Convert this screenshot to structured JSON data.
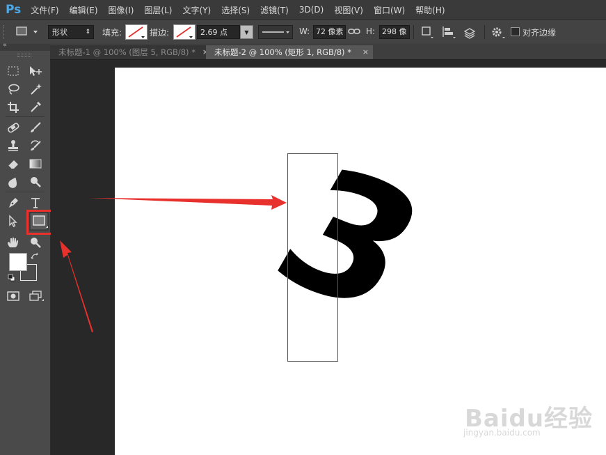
{
  "app": {
    "logo": "Ps"
  },
  "menu": [
    "文件(F)",
    "编辑(E)",
    "图像(I)",
    "图层(L)",
    "文字(Y)",
    "选择(S)",
    "滤镜(T)",
    "3D(D)",
    "视图(V)",
    "窗口(W)",
    "帮助(H)"
  ],
  "options": {
    "mode": "形状",
    "fill_label": "填充:",
    "stroke_label": "描边:",
    "stroke_width": "2.69 点",
    "w_label": "W:",
    "w_value": "72 像素",
    "h_label": "H:",
    "h_value": "298 像",
    "align_edges_label": "对齐边缘",
    "align_edges_checked": false
  },
  "tabs": [
    {
      "label": "未标题-1 @ 100% (图层 5, RGB/8) *",
      "close": "×",
      "active": false
    },
    {
      "label": "未标题-2 @ 100% (矩形 1, RGB/8) *",
      "close": "×",
      "active": true
    }
  ],
  "canvas": {
    "glyph_text": "3",
    "foreground": "#000000",
    "background": "#ffffff"
  },
  "annotations": {
    "highlight_color": "#e8312d",
    "arrow_color": "#e8312d"
  },
  "watermark": {
    "brand": "Baidu经验",
    "url": "jingyan.baidu.com"
  },
  "colors": {
    "foreground_swatch": "#ffffff",
    "background_swatch": "#4a4a4a",
    "accent": "#4ea8e8"
  }
}
